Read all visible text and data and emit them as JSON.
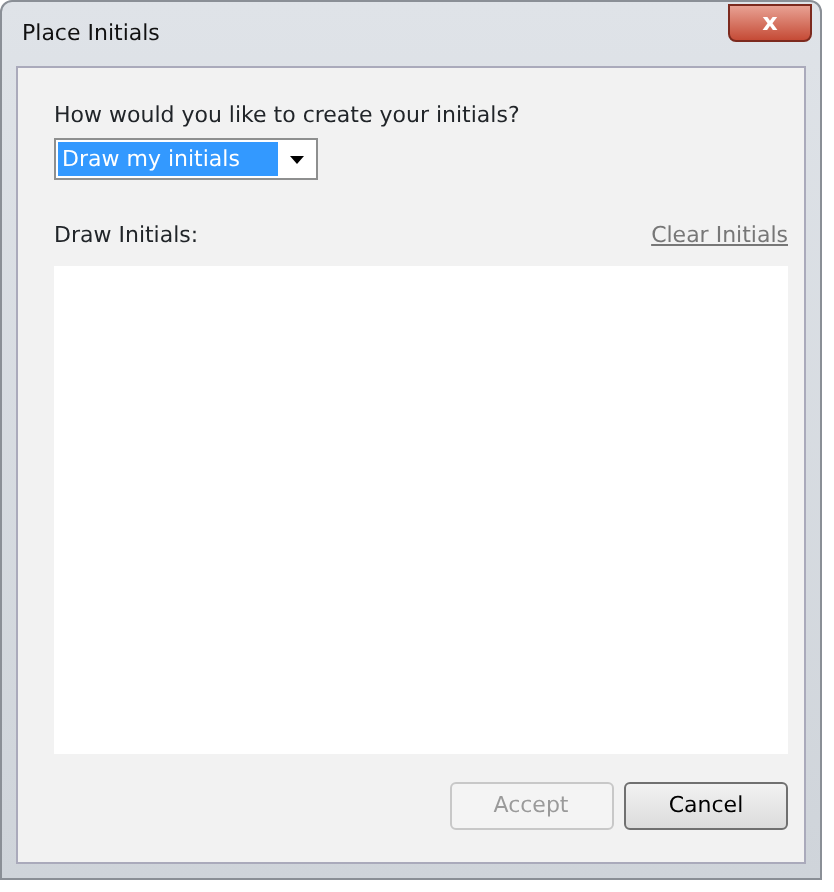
{
  "window": {
    "title": "Place Initials",
    "close": "x"
  },
  "prompt": "How would you like to create your initials?",
  "method_select": {
    "value": "Draw my initials",
    "focused": true
  },
  "draw_label": "Draw Initials:",
  "clear_link": "Clear Initials",
  "buttons": [
    {
      "label": "Accept",
      "disabled": true
    },
    {
      "label": "Cancel",
      "disabled": false
    }
  ]
}
